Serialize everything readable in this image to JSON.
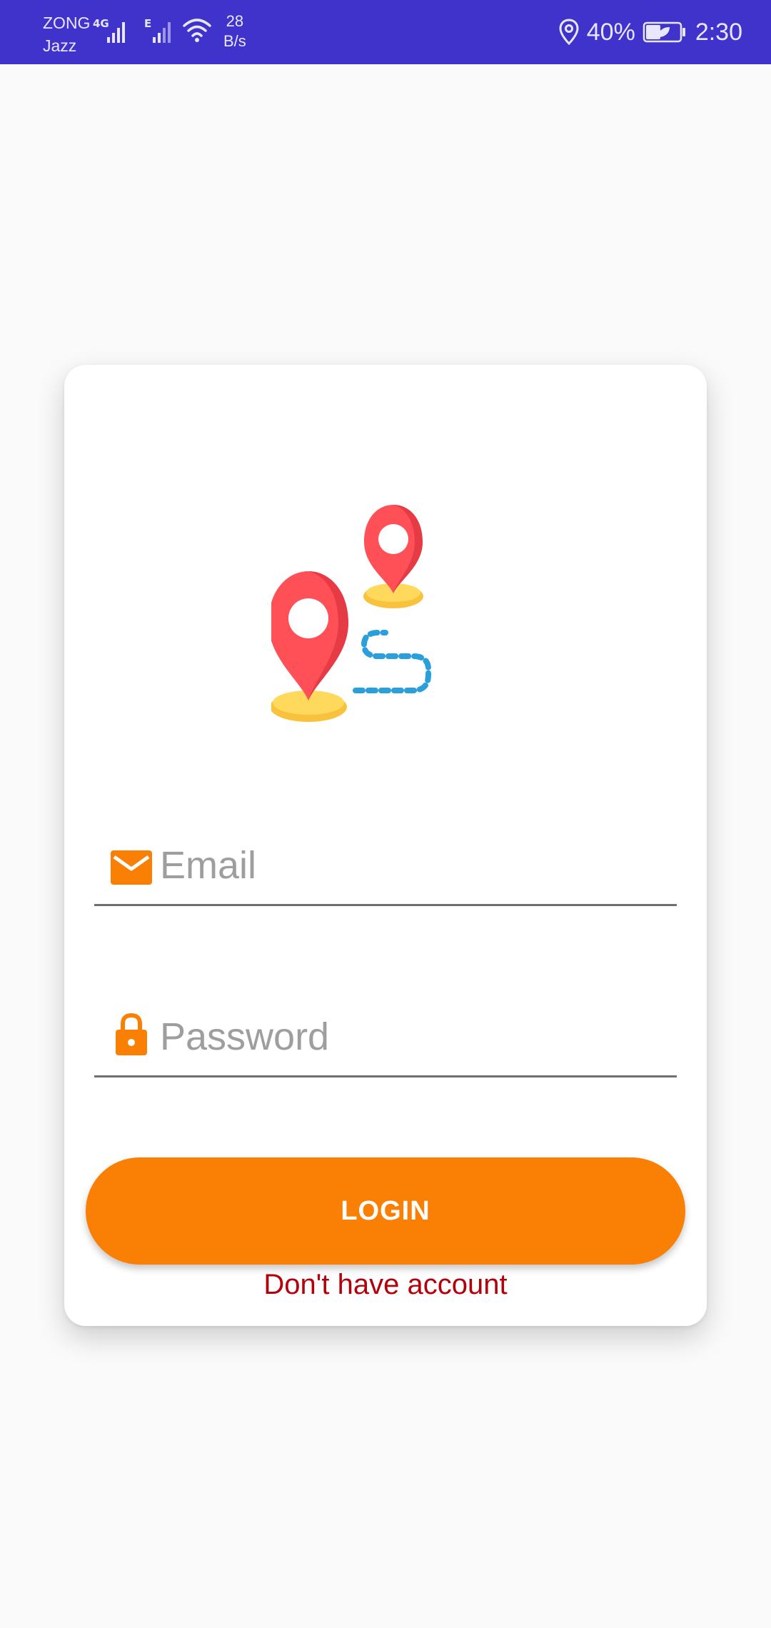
{
  "status_bar": {
    "carrier_1": "ZONG",
    "carrier_2": "Jazz",
    "network_type_1": "4G",
    "network_type_2": "E",
    "speed_value": "28",
    "speed_unit": "B/s",
    "battery": "40%",
    "time": "2:30",
    "icons": [
      "signal-icon",
      "wifi-icon",
      "location-icon",
      "battery-icon"
    ]
  },
  "login_form": {
    "logo": "map-pins-route-icon",
    "email": {
      "placeholder": "Email",
      "value": "",
      "icon": "mail-icon"
    },
    "password": {
      "placeholder": "Password",
      "value": "",
      "icon": "lock-icon"
    },
    "login_label": "LOGIN",
    "signup_label": "Don't have account"
  },
  "colors": {
    "status_bar": "#3f33cc",
    "accent": "#f98005",
    "link": "#b3000a",
    "pin": "#ff4f57",
    "route": "#2a9fdc"
  }
}
